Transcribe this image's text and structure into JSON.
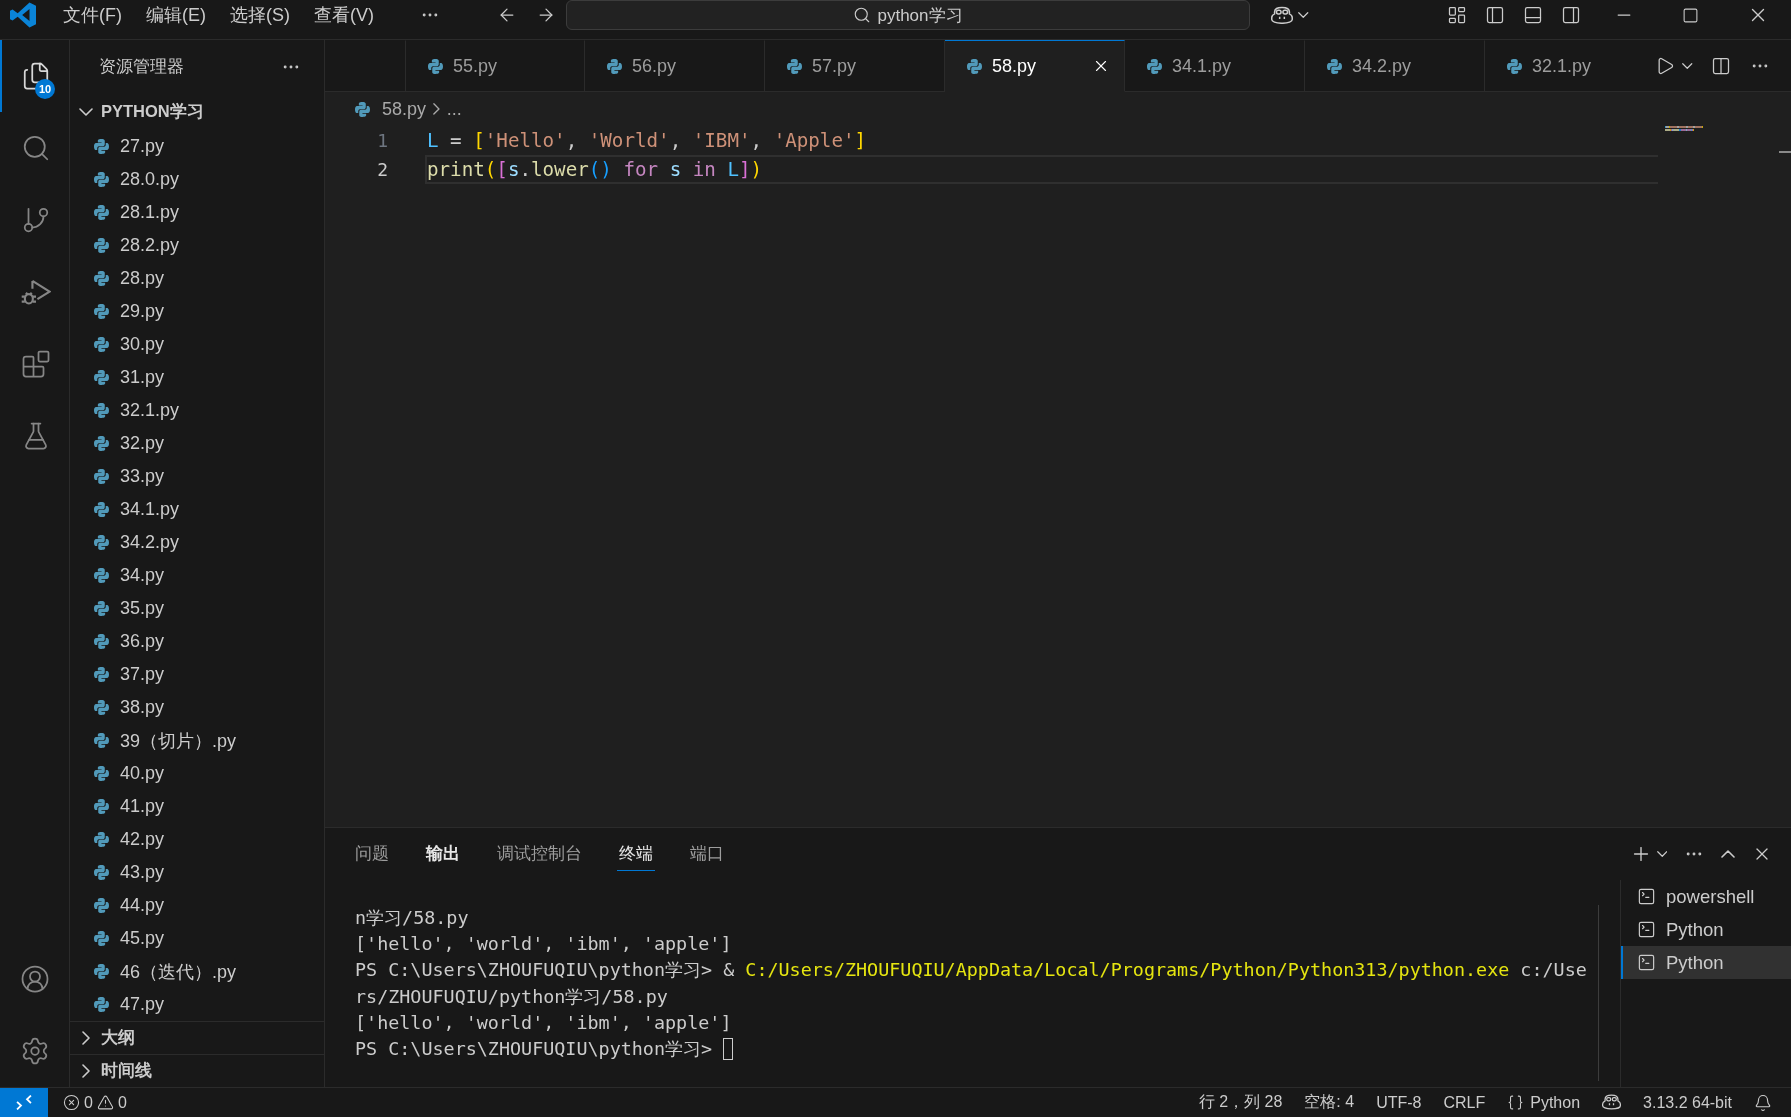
{
  "title_bar": {
    "menus": [
      "文件(F)",
      "编辑(E)",
      "选择(S)",
      "查看(V)"
    ],
    "command_center": {
      "label": "python学习"
    }
  },
  "activity_bar": {
    "items": [
      {
        "kind": "explorer",
        "selected": true,
        "badge": "10"
      },
      {
        "kind": "search",
        "selected": false
      },
      {
        "kind": "source_control",
        "selected": false
      },
      {
        "kind": "run_debug",
        "selected": false
      },
      {
        "kind": "extensions",
        "selected": false
      },
      {
        "kind": "testing",
        "selected": false
      }
    ],
    "bottom_items": [
      {
        "kind": "accounts"
      },
      {
        "kind": "settings"
      }
    ]
  },
  "explorer": {
    "title": "资源管理器",
    "folder": {
      "name": "PYTHON学习",
      "expanded": true,
      "files": [
        "27.py",
        "28.0.py",
        "28.1.py",
        "28.2.py",
        "28.py",
        "29.py",
        "30.py",
        "31.py",
        "32.1.py",
        "32.py",
        "33.py",
        "34.1.py",
        "34.2.py",
        "34.py",
        "35.py",
        "36.py",
        "37.py",
        "38.py",
        "39（切片）.py",
        "40.py",
        "41.py",
        "42.py",
        "43.py",
        "44.py",
        "45.py",
        "46（迭代）.py",
        "47.py"
      ]
    },
    "sections": [
      {
        "name": "大纲",
        "expanded": false
      },
      {
        "name": "时间线",
        "expanded": false
      }
    ]
  },
  "tabs": [
    {
      "label": "55.py",
      "selected": false
    },
    {
      "label": "56.py",
      "selected": false
    },
    {
      "label": "57.py",
      "selected": false
    },
    {
      "label": "58.py",
      "selected": true
    },
    {
      "label": "34.1.py",
      "selected": false
    },
    {
      "label": "34.2.py",
      "selected": false
    },
    {
      "label": "32.1.py",
      "selected": false
    }
  ],
  "breadcrumb": [
    "58.py",
    "..."
  ],
  "editor": {
    "lines": [
      {
        "number": "1",
        "current": false,
        "tokens": [
          {
            "text": "L",
            "kind": "constant"
          },
          {
            "text": " = ",
            "kind": "plain"
          },
          {
            "text": "[",
            "kind": "bracket1"
          },
          {
            "text": "'Hello'",
            "kind": "string"
          },
          {
            "text": ", ",
            "kind": "plain"
          },
          {
            "text": "'World'",
            "kind": "string"
          },
          {
            "text": ", ",
            "kind": "plain"
          },
          {
            "text": "'IBM'",
            "kind": "string"
          },
          {
            "text": ", ",
            "kind": "plain"
          },
          {
            "text": "'Apple'",
            "kind": "string"
          },
          {
            "text": "]",
            "kind": "bracket1"
          }
        ]
      },
      {
        "number": "2",
        "current": true,
        "tokens": [
          {
            "text": "print",
            "kind": "function"
          },
          {
            "text": "(",
            "kind": "bracket1"
          },
          {
            "text": "[",
            "kind": "bracket2"
          },
          {
            "text": "s",
            "kind": "variable"
          },
          {
            "text": ".",
            "kind": "plain"
          },
          {
            "text": "lower",
            "kind": "function"
          },
          {
            "text": "()",
            "kind": "bracket3"
          },
          {
            "text": " for ",
            "kind": "keyword"
          },
          {
            "text": "s",
            "kind": "variable"
          },
          {
            "text": " in ",
            "kind": "keyword"
          },
          {
            "text": "L",
            "kind": "constant"
          },
          {
            "text": "]",
            "kind": "bracket2"
          },
          {
            "text": ")",
            "kind": "bracket1"
          }
        ]
      }
    ]
  },
  "panel": {
    "tabs": [
      {
        "label": "问题",
        "selected": false,
        "hovered": false
      },
      {
        "label": "输出",
        "selected": false,
        "hovered": true
      },
      {
        "label": "调试控制台",
        "selected": false,
        "hovered": false
      },
      {
        "label": "终端",
        "selected": true,
        "hovered": false
      },
      {
        "label": "端口",
        "selected": false,
        "hovered": false
      }
    ],
    "terminal_lines": [
      {
        "cursor": false,
        "segments": [
          {
            "text": "n学习/58.py",
            "kind": "plain"
          }
        ]
      },
      {
        "cursor": false,
        "segments": [
          {
            "text": "['hello', 'world', 'ibm', 'apple']",
            "kind": "plain"
          }
        ]
      },
      {
        "cursor": false,
        "segments": [
          {
            "text": "PS C:\\Users\\ZHOUFUQIU\\python学习> & ",
            "kind": "plain"
          },
          {
            "text": "C:/Users/ZHOUFUQIU/AppData/Local/Programs/Python/Python313/python.exe",
            "kind": "path"
          },
          {
            "text": " c:/Use",
            "kind": "plain"
          }
        ]
      },
      {
        "cursor": false,
        "segments": [
          {
            "text": "rs/ZHOUFUQIU/python学习/58.py",
            "kind": "plain"
          }
        ]
      },
      {
        "cursor": false,
        "segments": [
          {
            "text": "['hello', 'world', 'ibm', 'apple']",
            "kind": "plain"
          }
        ]
      },
      {
        "cursor": true,
        "segments": [
          {
            "text": "PS C:\\Users\\ZHOUFUQIU\\python学习> ",
            "kind": "plain"
          }
        ]
      }
    ],
    "terminals": [
      {
        "label": "powershell",
        "selected": false
      },
      {
        "label": "Python",
        "selected": false
      },
      {
        "label": "Python",
        "selected": true
      }
    ]
  },
  "status_bar": {
    "errors": "0",
    "warnings": "0",
    "items": [
      {
        "kind": "text",
        "text": "行 2，列 28"
      },
      {
        "kind": "text",
        "text": "空格: 4"
      },
      {
        "kind": "text",
        "text": "UTF-8"
      },
      {
        "kind": "text",
        "text": "CRLF"
      },
      {
        "kind": "language",
        "text": "Python"
      },
      {
        "kind": "assistant"
      },
      {
        "kind": "text",
        "text": "3.13.2 64-bit"
      },
      {
        "kind": "notifications"
      }
    ]
  }
}
